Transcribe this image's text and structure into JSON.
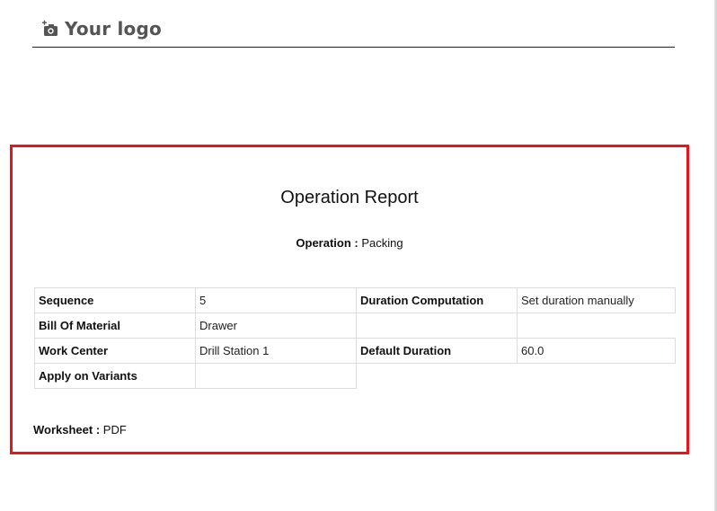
{
  "header": {
    "logo_text": "Your logo",
    "logo_icon": "camera-plus-icon"
  },
  "report": {
    "title": "Operation Report",
    "operation_label": "Operation :",
    "operation_value": "Packing",
    "rows": [
      {
        "left_label": "Sequence",
        "left_value": "5",
        "right_label": "Duration Computation",
        "right_value": "Set duration manually"
      },
      {
        "left_label": "Bill Of Material",
        "left_value": "Drawer",
        "right_label": "",
        "right_value": ""
      },
      {
        "left_label": "Work Center",
        "left_value": "Drill Station 1",
        "right_label": "Default Duration",
        "right_value": "60.0"
      },
      {
        "left_label": "Apply on Variants",
        "left_value": "",
        "right_label": "",
        "right_value": ""
      }
    ],
    "worksheet_label": "Worksheet :",
    "worksheet_value": "PDF"
  },
  "colors": {
    "highlight_border": "#e8141a",
    "cell_border": "#dcdcdc",
    "logo_gray": "#555555"
  }
}
